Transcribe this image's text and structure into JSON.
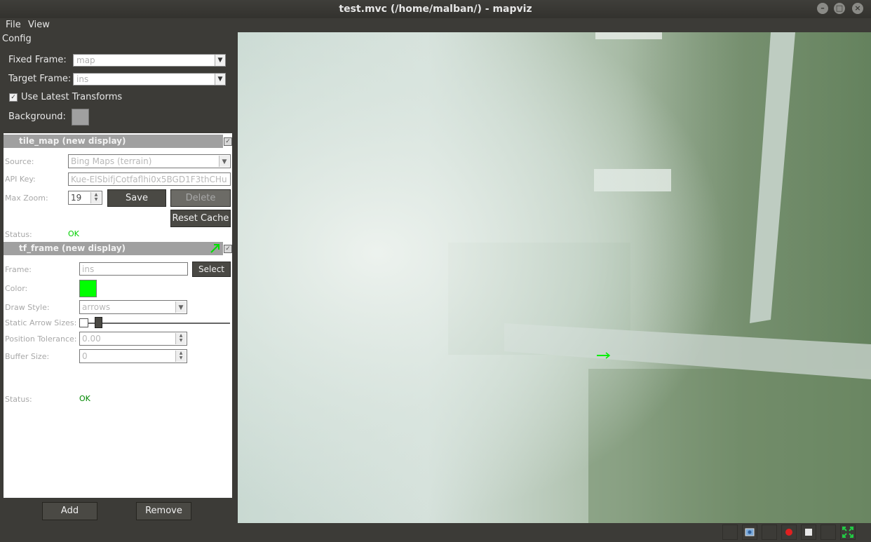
{
  "window": {
    "title": "test.mvc (/home/malban/) - mapviz",
    "buttons": {
      "minimize": "–",
      "maximize": "□",
      "close": "×"
    }
  },
  "menu": {
    "file": "File",
    "view": "View"
  },
  "config": {
    "title": "Config",
    "fixed_frame_label": "Fixed Frame:",
    "fixed_frame_value": "map",
    "target_frame_label": "Target Frame:",
    "target_frame_value": "ins",
    "use_latest_label": "Use Latest Transforms",
    "use_latest_checked": true,
    "background_label": "Background:",
    "background_color": "#a0a0a0"
  },
  "tile_map": {
    "header": "tile_map (new display)",
    "source_label": "Source:",
    "source_value": "Bing Maps (terrain)",
    "api_key_label": "API Key:",
    "api_key_value": "Kue-ElSbifjCotfaflhi0x5BGD1F3thCHu",
    "max_zoom_label": "Max Zoom:",
    "max_zoom_value": "19",
    "save_label": "Save",
    "delete_label": "Delete",
    "reset_cache_label": "Reset Cache",
    "status_label": "Status:",
    "status_value": "OK"
  },
  "tf_frame": {
    "header": "tf_frame (new display)",
    "frame_label": "Frame:",
    "frame_value": "ins",
    "select_label": "Select",
    "color_label": "Color:",
    "color_value": "#00ff00",
    "draw_style_label": "Draw Style:",
    "draw_style_value": "arrows",
    "static_arrow_label": "Static Arrow Sizes:",
    "position_tolerance_label": "Position Tolerance:",
    "position_tolerance_value": "0.00",
    "buffer_size_label": "Buffer Size:",
    "buffer_size_value": "0",
    "status_label": "Status:",
    "status_value": "OK"
  },
  "buttons": {
    "add": "Add",
    "remove": "Remove"
  },
  "colors": {
    "ok_green_1": "#00d000",
    "ok_green_2": "#008800",
    "accent": "#00ff00"
  },
  "statusbar_icons": [
    "screenshot-icon",
    "record-icon",
    "stop-icon",
    "fullscreen-icon"
  ]
}
